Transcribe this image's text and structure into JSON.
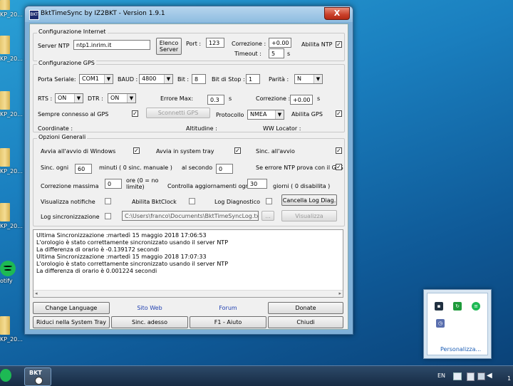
{
  "desktop": {
    "icons": [
      {
        "label": "KP_20..."
      },
      {
        "label": "KP_20..."
      },
      {
        "label": "KP_20..."
      },
      {
        "label": "KP_20..."
      },
      {
        "label": "KP_20..."
      },
      {
        "label": "KP_20..."
      },
      {
        "label": "otify"
      },
      {
        "label": "KP_20..."
      }
    ]
  },
  "window": {
    "title": "BktTimeSync by IZ2BKT - Version 1.9.1",
    "icon_label": "BKT",
    "close_label": "X"
  },
  "internet": {
    "group_title": "Configurazione Internet",
    "server_label": "Server NTP",
    "server_value": "ntp1.inrim.it",
    "server_list_button": "Elenco\nServer",
    "port_label": "Port :",
    "port_value": "123",
    "correction_label": "Correzione :",
    "correction_value": "+0.00",
    "timeout_label": "Timeout :",
    "timeout_value": "5",
    "timeout_unit": "s",
    "enable_ntp_label": "Abilita NTP",
    "enable_ntp_checked": true
  },
  "gps": {
    "group_title": "Configurazione GPS",
    "serial_label": "Porta Seriale:",
    "serial_value": "COM1",
    "baud_label": "BAUD :",
    "baud_value": "4800",
    "bits_label": "Bit :",
    "bits_value": "8",
    "stopbits_label": "Bit di Stop :",
    "stopbits_value": "1",
    "parity_label": "Parità :",
    "parity_value": "N",
    "rts_label": "RTS :",
    "rts_value": "ON",
    "dtr_label": "DTR :",
    "dtr_value": "ON",
    "maxerr_label": "Errore Max:",
    "maxerr_value": "0.3",
    "maxerr_unit": "s",
    "correction_label": "Correzione :",
    "correction_value": "+0.00",
    "correction_unit": "s",
    "always_connected_label": "Sempre connesso al GPS",
    "always_connected_checked": true,
    "disconnect_button": "Sconnetti GPS",
    "protocol_label": "Protocollo",
    "protocol_value": "NMEA",
    "enable_gps_label": "Abilita GPS",
    "enable_gps_checked": true,
    "coords_label": "Coordinate :",
    "altitude_label": "Altitudine :",
    "locator_label": "WW Locator :"
  },
  "general": {
    "group_title": "Opzioni Generali",
    "start_windows_label": "Avvia all'avvio di Windows",
    "start_windows_checked": true,
    "start_tray_label": "Avvia in system tray",
    "start_tray_checked": true,
    "sync_start_label": "Sinc. all'avvio",
    "sync_start_checked": true,
    "sync_every_label": "Sinc. ogni",
    "sync_every_value": "60",
    "sync_every_unit": "minuti ( 0 sinc. manuale )",
    "per_second_label": "al secondo",
    "per_second_value": "0",
    "ntp_error_gps_label": "Se errore NTP prova con il GPS",
    "ntp_error_gps_checked": true,
    "max_correction_label": "Correzione massima",
    "max_correction_value": "0",
    "max_correction_unit": "ore (0 = no limite)",
    "check_updates_label": "Controlla aggiornamenti ogni",
    "check_updates_value": "30",
    "check_updates_unit": "giorni ( 0 disabilita )",
    "notifications_label": "Visualizza notifiche",
    "notifications_checked": false,
    "bktclock_label": "Abilita BktClock",
    "bktclock_checked": false,
    "diag_log_label": "Log Diagnostico",
    "diag_log_checked": false,
    "clear_diag_button": "Cancella Log Diag.",
    "sync_log_label": "Log sincronizzazione",
    "sync_log_checked": false,
    "log_path": "C:\\Users\\franco\\Documents\\BktTimeSyncLog.txt",
    "browse_button": "...",
    "view_button": "Visualizza"
  },
  "log": {
    "lines": [
      "Ultima Sincronizzazione :martedì 15 maggio 2018 17:06:53",
      "L'orologio è stato correttamente sincronizzato usando il server NTP",
      "La differenza di orario è -0.139172 secondi",
      "Ultima Sincronizzazione :martedì 15 maggio 2018 17:07:33",
      "L'orologio è stato correttamente sincronizzato usando il server NTP",
      "La differenza di orario è 0.001224 secondi"
    ],
    "scroll_left": "◂",
    "scroll_right": "▸"
  },
  "footer": {
    "change_language": "Change Language",
    "website": "Sito Web",
    "forum": "Forum",
    "donate": "Donate",
    "minimize_tray": "Riduci nella System Tray",
    "sync_now": "Sinc. adesso",
    "help": "F1 - Aiuto",
    "close": "Chiudi"
  },
  "tray_popup": {
    "customize_link": "Personalizza..."
  },
  "taskbar": {
    "language": "EN",
    "clock": "1"
  }
}
